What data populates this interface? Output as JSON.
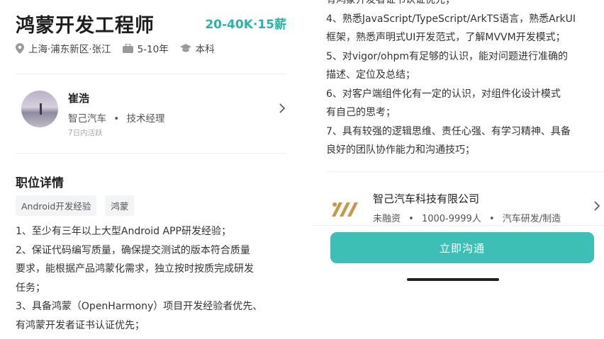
{
  "job": {
    "title": "鸿蒙开发工程师",
    "salary": "20-40K·15薪",
    "location": "上海·浦东新区·张江",
    "experience": "5-10年",
    "education": "本科"
  },
  "recruiter": {
    "name": "崔浩",
    "company": "智己汽车",
    "separator": "•",
    "position": "技术经理",
    "active": "7日内活跃"
  },
  "details": {
    "title": "职位详情",
    "tags": [
      "Android开发经验",
      "鸿蒙"
    ],
    "lines": [
      "1、至少有三年以上大型Android APP研发经验；",
      "2、保证代码编写质量，确保提交测试的版本符合质量",
      "要求，能根据产品鸿蒙化需求，独立按时按质完成研发",
      "任务；",
      "3、具备鸿蒙（OpenHarmony）项目开发经验者优先、",
      "有鸿蒙开发者证书认证优先；"
    ]
  },
  "requirements": {
    "lines": [
      "有鸿蒙开发者证书认证优先；",
      "4、熟悉JavaScript/TypeScript/ArkTS语言，熟悉ArkUI",
      "框架，熟悉声明式UI开发范式，了解MVVM开发模式；",
      "5、对vigor/ohpm有足够的认识，能对问题进行准确的",
      "描述、定位及总结；",
      "6、对客户端组件化有一定的认识，对组件化设计模式",
      "有自己的思考；",
      "7、具有较强的逻辑思维、责任心强、有学习精神、具备",
      "良好的团队协作能力和沟通技巧；"
    ]
  },
  "company": {
    "name": "智己汽车科技有限公司",
    "funding": "未融资",
    "size": "1000-9999人",
    "industry": "汽车研发/制造",
    "separator": "•"
  },
  "actions": {
    "chat_label": "立即沟通"
  },
  "colors": {
    "accent": "#2bb3a6",
    "button": "#3dbfb6",
    "logo": "#c49a4a"
  }
}
